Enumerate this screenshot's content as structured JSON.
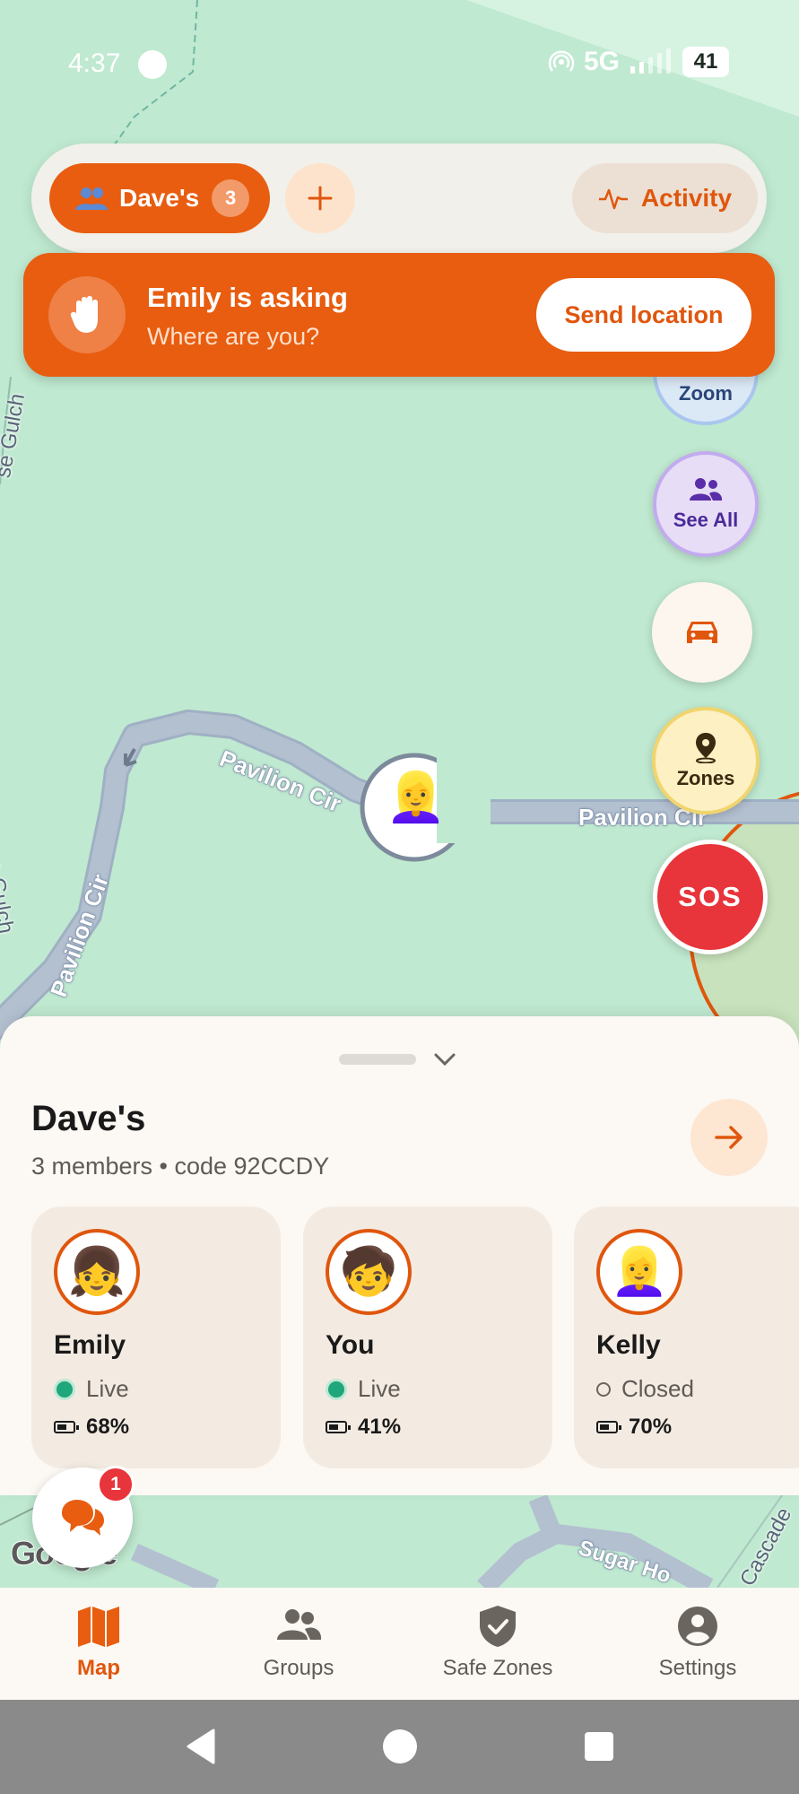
{
  "status_bar": {
    "time": "4:37",
    "network": "5G",
    "battery": "41"
  },
  "group_bar": {
    "group_name": "Dave's",
    "member_count": "3",
    "activity_label": "Activity"
  },
  "request_banner": {
    "title": "Emily is asking",
    "subtitle": "Where are you?",
    "action_label": "Send location"
  },
  "map_controls": {
    "zoom_label": "Zoom",
    "see_all_label": "See All",
    "zones_label": "Zones",
    "sos_label": "SOS"
  },
  "map_labels": {
    "road_1": "Pavilion Cir",
    "road_2": "Pavilion Cir",
    "road_3": "Pavilion Cir",
    "road_4": "Sugar Ho",
    "street_left_1": "se Gulch",
    "street_left_2": "Goose Gulch",
    "street_right": "Cascade",
    "google": "Google"
  },
  "group_sheet": {
    "title": "Dave's",
    "subtitle": "3 members • code 92CCDY",
    "members": [
      {
        "name": "Emily",
        "avatar": "👧",
        "status": "Live",
        "battery": "68%"
      },
      {
        "name": "You",
        "avatar": "🧒",
        "status": "Live",
        "battery": "41%"
      },
      {
        "name": "Kelly",
        "avatar": "👱‍♀️",
        "status": "Closed",
        "battery": "70%"
      }
    ]
  },
  "chat": {
    "unread_count": "1"
  },
  "bottom_nav": {
    "items": [
      {
        "label": "Map",
        "active": true
      },
      {
        "label": "Groups",
        "active": false
      },
      {
        "label": "Safe Zones",
        "active": false
      },
      {
        "label": "Settings",
        "active": false
      }
    ]
  },
  "colors": {
    "accent": "#e85d10",
    "map_bg": "#bfe9d0",
    "sos": "#e8343b",
    "road": "#b3c0d0"
  }
}
